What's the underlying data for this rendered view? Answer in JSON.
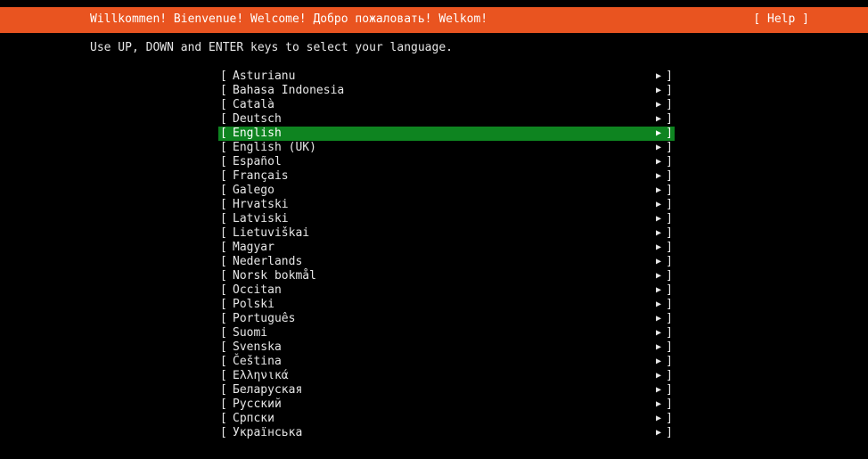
{
  "header": {
    "title": "Willkommen! Bienvenue! Welcome! Добро пожаловать! Welkom!",
    "help_label": "[ Help ]",
    "accent_color": "#e95420"
  },
  "instructions": "Use UP, DOWN and ENTER keys to select your language.",
  "list": {
    "bracket_open": "[",
    "bracket_close": "]",
    "arrow": "▶",
    "selected_color": "#0e8420",
    "items": [
      {
        "label": "Asturianu"
      },
      {
        "label": "Bahasa Indonesia"
      },
      {
        "label": "Català"
      },
      {
        "label": "Deutsch"
      },
      {
        "label": "English",
        "selected": true
      },
      {
        "label": "English (UK)"
      },
      {
        "label": "Español"
      },
      {
        "label": "Français"
      },
      {
        "label": "Galego"
      },
      {
        "label": "Hrvatski"
      },
      {
        "label": "Latviski"
      },
      {
        "label": "Lietuviškai"
      },
      {
        "label": "Magyar"
      },
      {
        "label": "Nederlands"
      },
      {
        "label": "Norsk bokmål"
      },
      {
        "label": "Occitan"
      },
      {
        "label": "Polski"
      },
      {
        "label": "Português"
      },
      {
        "label": "Suomi"
      },
      {
        "label": "Svenska"
      },
      {
        "label": "Čeština"
      },
      {
        "label": "Ελληνικά"
      },
      {
        "label": "Беларуская"
      },
      {
        "label": "Русский"
      },
      {
        "label": "Српски"
      },
      {
        "label": "Українська"
      }
    ]
  }
}
